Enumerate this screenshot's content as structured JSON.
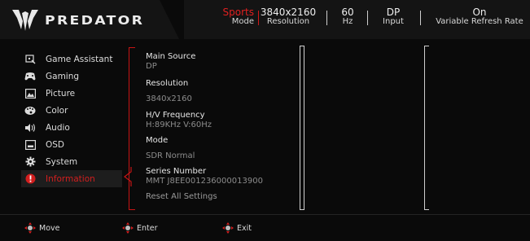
{
  "brand": {
    "name": "PREDATOR"
  },
  "header": {
    "mode": {
      "value": "Sports",
      "label": "Mode"
    },
    "resolution": {
      "value": "3840x2160",
      "label": "Resolution"
    },
    "refresh": {
      "value": "60",
      "label": "Hz"
    },
    "input": {
      "value": "DP",
      "label": "Input"
    },
    "vrr": {
      "value": "On",
      "label": "Variable Refresh Rate"
    }
  },
  "menu": {
    "items": [
      {
        "label": "Game Assistant",
        "icon": "game-assistant-icon"
      },
      {
        "label": "Gaming",
        "icon": "gamepad-icon"
      },
      {
        "label": "Picture",
        "icon": "picture-icon"
      },
      {
        "label": "Color",
        "icon": "palette-icon"
      },
      {
        "label": "Audio",
        "icon": "speaker-icon"
      },
      {
        "label": "OSD",
        "icon": "osd-icon"
      },
      {
        "label": "System",
        "icon": "gear-icon"
      },
      {
        "label": "Information",
        "icon": "info-icon",
        "active": true
      }
    ]
  },
  "info": {
    "main_source_label": "Main Source",
    "main_source_value": "DP",
    "resolution_label": "Resolution",
    "resolution_value": "3840x2160",
    "hv_label": "H/V Frequency",
    "hv_value": "H:89KHz  V:60Hz",
    "mode_label": "Mode",
    "mode_value": "SDR Normal",
    "series_label": "Series Number",
    "series_value": "MMT J8EE001236000013900",
    "reset_label": "Reset All Settings"
  },
  "footer": {
    "move": "Move",
    "enter": "Enter",
    "exit": "Exit"
  },
  "colors": {
    "accent": "#d21e1e",
    "background": "#0a0a0a",
    "header": "#141414"
  }
}
